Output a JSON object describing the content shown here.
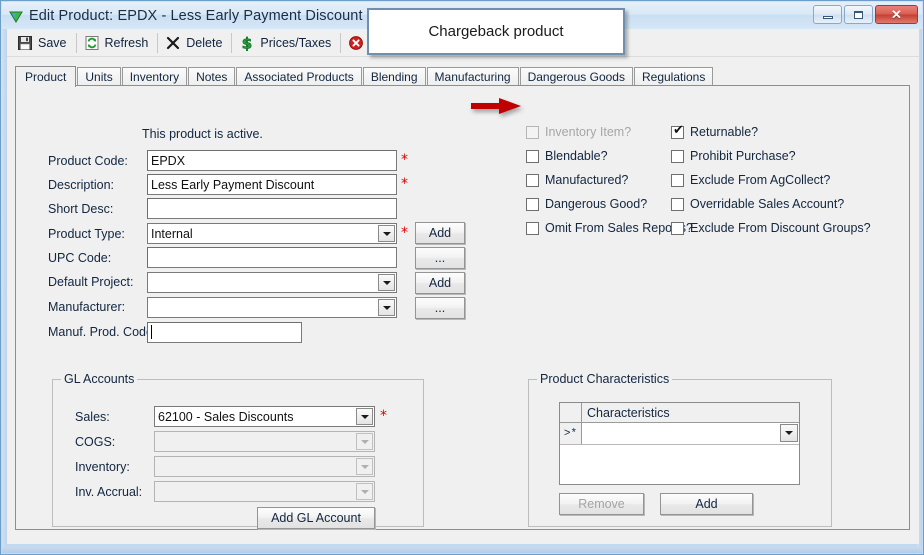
{
  "window": {
    "title": "Edit Product: EPDX - Less Early Payment Discount",
    "app_icon": "triangle-icon",
    "minimize_label": "Minimize",
    "maximize_label": "Maximize",
    "close_label": "Close"
  },
  "toolbar": {
    "buttons": [
      {
        "label": "Save",
        "icon": "save-floppy-icon"
      },
      {
        "label": "Refresh",
        "icon": "refresh-icon"
      },
      {
        "label": "Delete",
        "icon": "delete-x-icon"
      },
      {
        "label": "Prices/Taxes",
        "icon": "dollar-icon"
      },
      {
        "label": "Exit",
        "icon": "exit-icon"
      }
    ]
  },
  "tabs": [
    {
      "label": "Product",
      "active": true
    },
    {
      "label": "Units",
      "active": false
    },
    {
      "label": "Inventory",
      "active": false
    },
    {
      "label": "Notes",
      "active": false
    },
    {
      "label": "Associated Products",
      "active": false
    },
    {
      "label": "Blending",
      "active": false
    },
    {
      "label": "Manufacturing",
      "active": false
    },
    {
      "label": "Dangerous Goods",
      "active": false
    },
    {
      "label": "Regulations",
      "active": false
    }
  ],
  "form": {
    "status_text": "This product is active.",
    "fields": [
      {
        "label": "Product Code:",
        "value": "EPDX",
        "required": true,
        "type": "text"
      },
      {
        "label": "Description:",
        "value": "Less Early Payment Discount",
        "required": true,
        "type": "text"
      },
      {
        "label": "Short Desc:",
        "value": "",
        "required": false,
        "type": "text"
      },
      {
        "label": "Product Type:",
        "value": "Internal",
        "required": true,
        "type": "combo"
      },
      {
        "label": "UPC Code:",
        "value": "",
        "required": false,
        "type": "text"
      },
      {
        "label": "Default Project:",
        "value": "",
        "required": false,
        "type": "combo"
      },
      {
        "label": "Manufacturer:",
        "value": "",
        "required": false,
        "type": "combo"
      },
      {
        "label": "Manuf. Prod. Code:",
        "value": "",
        "required": false,
        "type": "text"
      }
    ],
    "side_buttons": [
      {
        "label": "Add"
      },
      {
        "label": "..."
      },
      {
        "label": "Add"
      },
      {
        "label": "..."
      }
    ]
  },
  "checkboxes": {
    "left_column": [
      {
        "label": "Inventory Item?",
        "checked": false,
        "disabled": true
      },
      {
        "label": "Blendable?",
        "checked": false,
        "disabled": false
      },
      {
        "label": "Manufactured?",
        "checked": false,
        "disabled": false
      },
      {
        "label": "Dangerous Good?",
        "checked": false,
        "disabled": false
      },
      {
        "label": "Omit From Sales Reports?",
        "checked": false,
        "disabled": false
      }
    ],
    "right_column": [
      {
        "label": "Returnable?",
        "checked": true,
        "disabled": false
      },
      {
        "label": "Prohibit Purchase?",
        "checked": false,
        "disabled": false
      },
      {
        "label": "Exclude From AgCollect?",
        "checked": false,
        "disabled": false
      },
      {
        "label": "Overridable Sales Account?",
        "checked": false,
        "disabled": false
      },
      {
        "label": "Exclude From Discount Groups?",
        "checked": false,
        "disabled": false
      }
    ],
    "check_mark": "✔"
  },
  "gl_accounts": {
    "title": "GL Accounts",
    "rows": [
      {
        "label": "Sales:",
        "value": "62100 - Sales Discounts",
        "required": true,
        "disabled": false
      },
      {
        "label": "COGS:",
        "value": "",
        "required": false,
        "disabled": true
      },
      {
        "label": "Inventory:",
        "value": "",
        "required": false,
        "disabled": true
      },
      {
        "label": "Inv. Accrual:",
        "value": "",
        "required": false,
        "disabled": true
      }
    ],
    "add_button": "Add GL Account"
  },
  "product_characteristics": {
    "title": "Product Characteristics",
    "column_header": "Characteristics",
    "new_row_marker": ">*",
    "row_value": "",
    "remove_button": "Remove",
    "remove_disabled": true,
    "add_button": "Add"
  },
  "annotations": {
    "callout_text": "Chargeback product",
    "arrow_color": "#c00000",
    "callout_border_color": "#6e8fb0"
  }
}
